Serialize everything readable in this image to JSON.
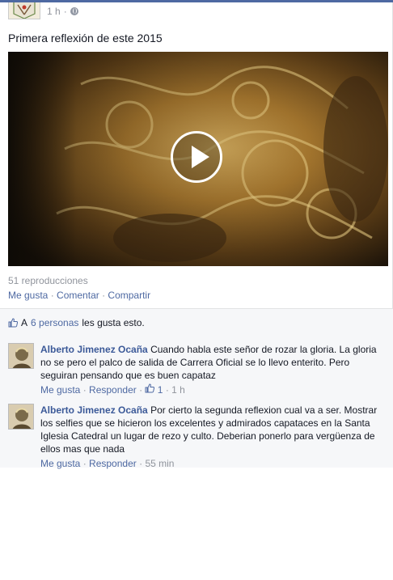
{
  "post": {
    "time": "1 h",
    "privacy_icon": "globe-icon",
    "text": "Primera reflexión de este 2015",
    "views": "51 reproducciones",
    "actions": [
      "Me gusta",
      "Comentar",
      "Compartir"
    ],
    "sep": "·"
  },
  "likes": {
    "prefix": "A",
    "count_link": "6 personas",
    "suffix": "les gusta esto."
  },
  "comments": [
    {
      "author": "Alberto Jimenez Ocaña",
      "text": "Cuando habla este señor de rozar la gloria. La gloria no se pero el palco de salida de Carrera Oficial se lo llevo enterito. Pero seguiran pensando que es buen capataz",
      "like_label": "Me gusta",
      "reply_label": "Responder",
      "like_count": "1",
      "time": "1 h"
    },
    {
      "author": "Alberto Jimenez Ocaña",
      "text": "Por cierto la segunda reflexion cual va a ser. Mostrar los selfies que se hicieron los excelentes y admirados capataces en la Santa Iglesia Catedral un lugar de rezo y culto. Deberian ponerlo para vergüenza de ellos mas que nada",
      "like_label": "Me gusta",
      "reply_label": "Responder",
      "time": "55 min"
    }
  ],
  "colors": {
    "link": "#4e69a2",
    "name": "#3b5998",
    "meta": "#90949c",
    "ufi_bg": "#f6f7f9"
  }
}
